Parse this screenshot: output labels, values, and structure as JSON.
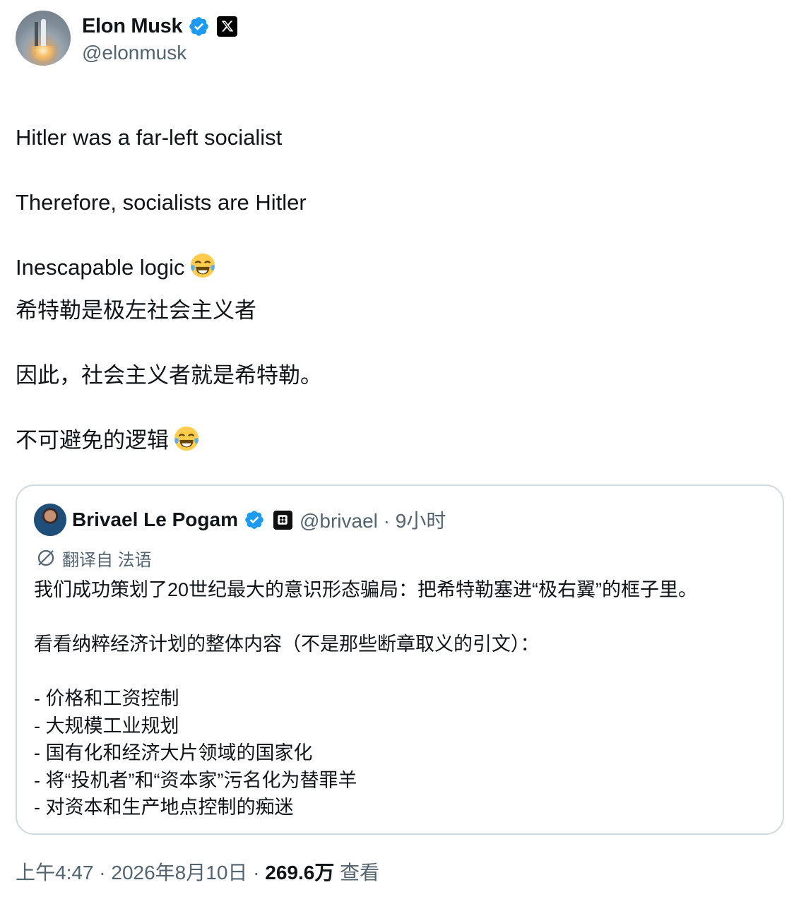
{
  "author": {
    "display_name": "Elon Musk",
    "handle": "@elonmusk",
    "verified": true,
    "affiliation_badge": "x-logo-icon"
  },
  "tweet": {
    "lines": [
      "Hitler was a far-left socialist",
      "Therefore, socialists are Hitler",
      "Inescapable logic",
      "希特勒是极左社会主义者",
      "因此，社会主义者就是希特勒。",
      "不可避免的逻辑"
    ],
    "emoji": "face-with-tears-of-joy-icon"
  },
  "quoted_tweet": {
    "display_name": "Brivael Le Pogam",
    "handle_time": "@brivael · 9小时",
    "verified": true,
    "translation_label": "翻译自 法语",
    "lines": [
      "我们成功策划了20世纪最大的意识形态骗局：把希特勒塞进“极右翼”的框子里。",
      "看看纳粹经济计划的整体内容（不是那些断章取义的引文）：",
      "- 价格和工资控制",
      "- 大规模工业规划",
      "- 国有化和经济大片领域的国家化",
      "- 将“投机者”和“资本家”污名化为替罪羊",
      "- 对资本和生产地点控制的痴迷"
    ]
  },
  "footer": {
    "time_date": "上午4:47 · 2026年8月10日 · ",
    "views_count": "269.6万",
    "views_label": " 查看"
  },
  "colors": {
    "verified_blue": "#1d9bf0",
    "secondary_text": "#536471",
    "border": "#cfd9de"
  }
}
